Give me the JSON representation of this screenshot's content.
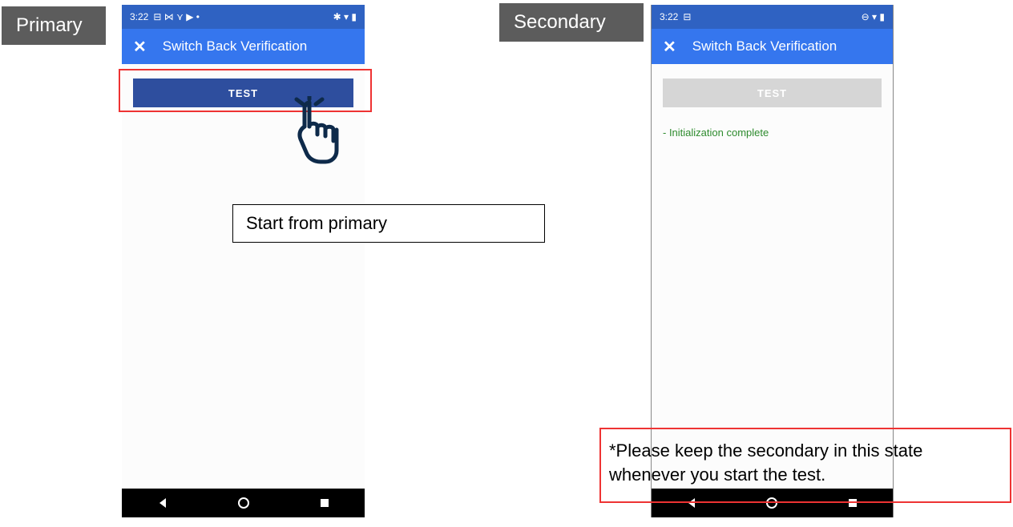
{
  "labels": {
    "primary": "Primary",
    "secondary": "Secondary"
  },
  "annotations": {
    "start": "Start from primary",
    "note": "*Please keep the secondary in this state whenever you start the test."
  },
  "primary": {
    "status": {
      "time": "3:22",
      "left_icons": "⊟ ⋈ ⋎ ▶ •",
      "right_icons": "✱ ▾ ▮"
    },
    "appbar": {
      "close": "✕",
      "title": "Switch Back Verification"
    },
    "test_button": "TEST"
  },
  "secondary": {
    "status": {
      "time": "3:22",
      "left_icons": "⊟",
      "right_icons": "⊖ ▾ ▮"
    },
    "appbar": {
      "close": "✕",
      "title": "Switch Back Verification"
    },
    "test_button": "TEST",
    "status_message": "- Initialization complete"
  }
}
